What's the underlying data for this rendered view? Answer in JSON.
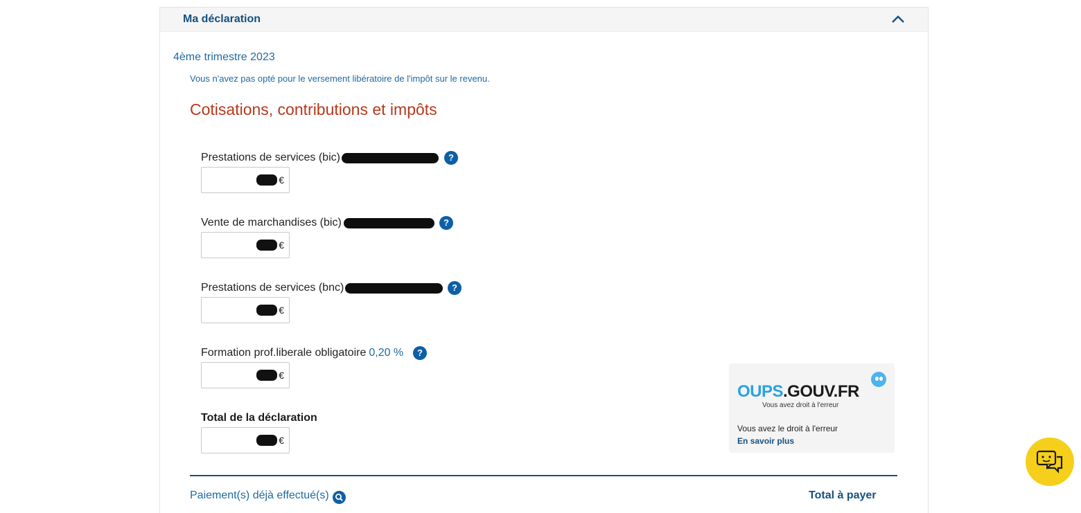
{
  "panel": {
    "title": "Ma déclaration",
    "chevron_icon": "chevron-up-icon"
  },
  "period": {
    "label": "4ème trimestre 2023"
  },
  "note": "Vous n'avez pas opté pour le versement libératoire de l'impôt sur le revenu.",
  "section_title": "Cotisations, contributions et impôts",
  "fields": [
    {
      "label": "Prestations de services (bic)",
      "currency": "€",
      "help_icon": "?"
    },
    {
      "label": "Vente de marchandises (bic)",
      "currency": "€",
      "help_icon": "?"
    },
    {
      "label": "Prestations de services (bnc)",
      "currency": "€",
      "help_icon": "?"
    },
    {
      "label": "Formation prof.liberale obligatoire",
      "rate": "0,20 %",
      "currency": "€",
      "help_icon": "?"
    }
  ],
  "total": {
    "label": "Total de la déclaration",
    "currency": "€"
  },
  "oups": {
    "logo_blue": "OUPS",
    "logo_dark": ".GOUV.FR",
    "tagline": "Vous avez droit à l'erreur",
    "text": "Vous avez le droit à l'erreur",
    "link": "En savoir plus"
  },
  "footer": {
    "payments_link": "Paiement(s) déjà effectué(s)",
    "total_to_pay": "Total à payer"
  },
  "colors": {
    "accent": "#15507f",
    "link": "#1e6aa0",
    "section_title": "#b7381c",
    "chat_button": "#f6cf1b"
  }
}
